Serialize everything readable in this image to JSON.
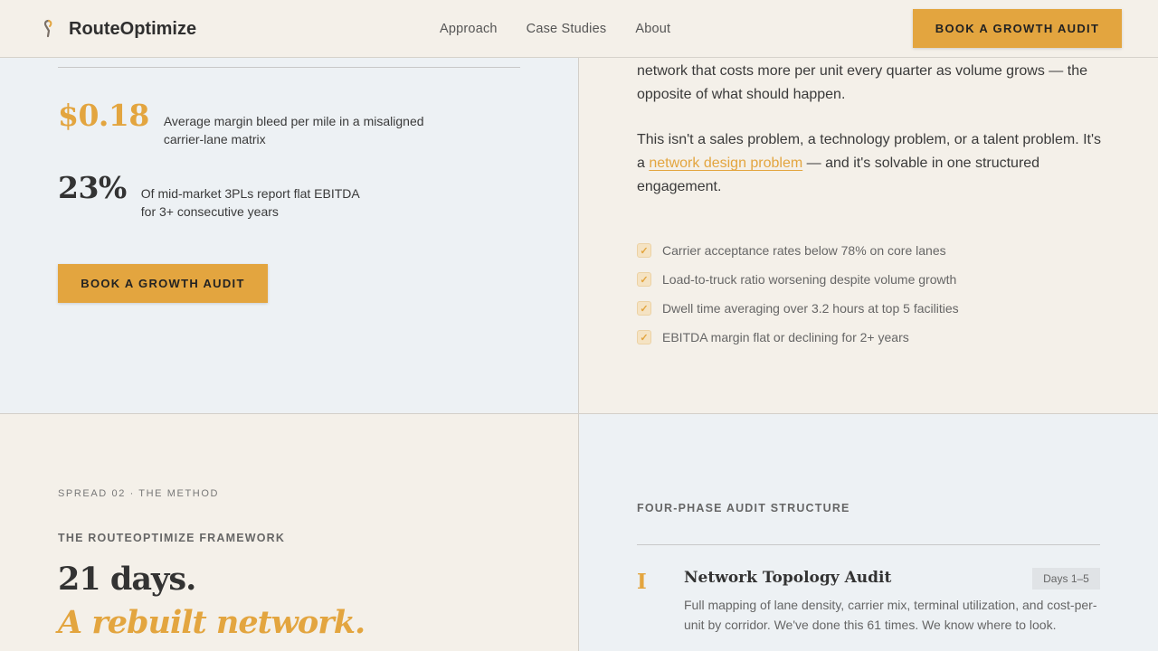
{
  "header": {
    "brand": "RouteOptimize",
    "logo_icon": "route-pin-icon",
    "nav": [
      "Approach",
      "Case Studies",
      "About"
    ],
    "cta": "BOOK A GROWTH AUDIT"
  },
  "problem": {
    "stats": [
      {
        "value": "$0.18",
        "desc": "Average margin bleed per mile in a misaligned carrier-lane matrix"
      },
      {
        "value": "23%",
        "desc": "Of mid-market 3PLs report flat EBITDA for 3+ consecutive years"
      }
    ],
    "cta": "BOOK A GROWTH AUDIT",
    "paragraph1": "network that costs more per unit every quarter as volume grows — the opposite of what should happen.",
    "paragraph2_pre": "This isn't a sales problem, a technology problem, or a talent problem. It's a ",
    "paragraph2_link": "network design problem",
    "paragraph2_post": " — and it's solvable in one structured engagement.",
    "checklist": [
      "Carrier acceptance rates below 78% on core lanes",
      "Load-to-truck ratio worsening despite volume growth",
      "Dwell time averaging over 3.2 hours at top 5 facilities",
      "EBITDA margin flat or declining for 2+ years"
    ],
    "check_glyph": "✓"
  },
  "method": {
    "eyebrow": "SPREAD 02 · THE METHOD",
    "framework": "THE ROUTEOPTIMIZE FRAMEWORK",
    "headline_line1": "21 days.",
    "headline_line2": "A rebuilt network.",
    "structure_label": "FOUR-PHASE AUDIT STRUCTURE",
    "phases": [
      {
        "numeral": "I",
        "title": "Network Topology Audit",
        "days": "Days 1–5",
        "desc": "Full mapping of lane density, carrier mix, terminal utilization, and cost-per-unit by corridor. We've done this 61 times. We know where to look."
      }
    ]
  },
  "colors": {
    "accent": "#e3a53f",
    "cream": "#f4f0e9",
    "slate": "#edf1f4",
    "text": "#333333"
  }
}
